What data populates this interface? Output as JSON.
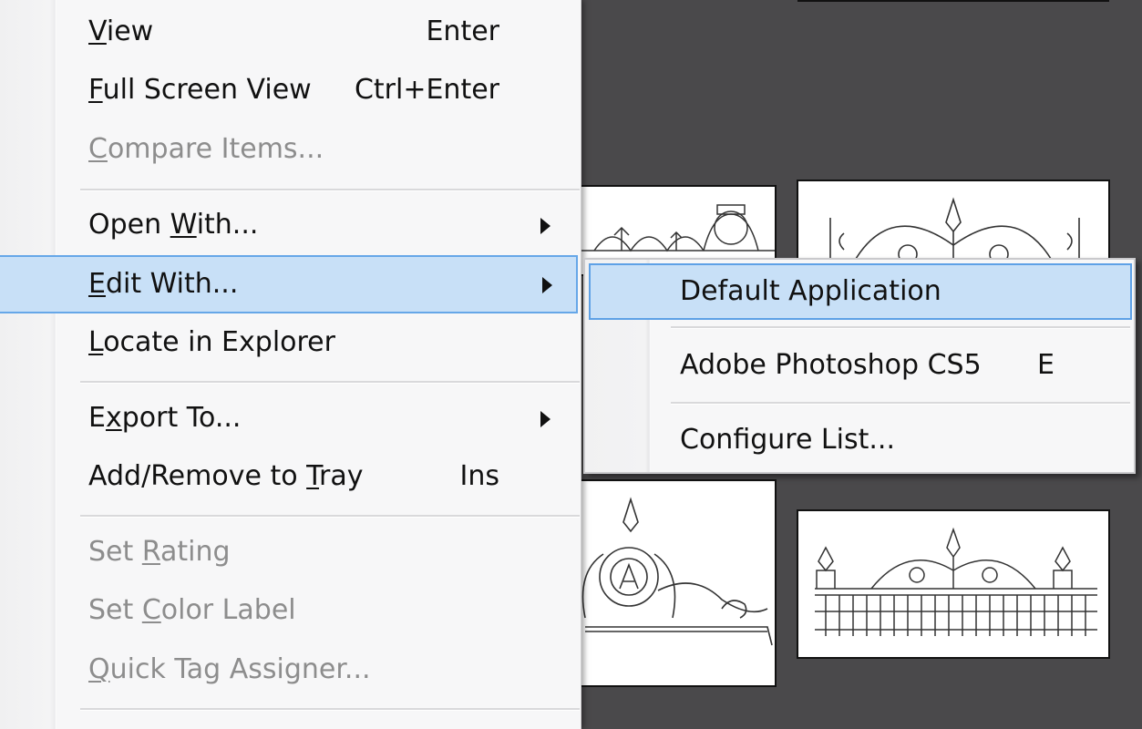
{
  "menu": {
    "items": [
      {
        "label": "View",
        "underline_index": 0,
        "shortcut": "Enter",
        "enabled": true
      },
      {
        "label": "Full Screen View",
        "underline_index": 0,
        "shortcut": "Ctrl+Enter",
        "enabled": true
      },
      {
        "label": "Compare Items...",
        "underline_index": 0,
        "shortcut": "",
        "enabled": false
      },
      {
        "label": "Open With...",
        "underline_index": 5,
        "shortcut": "",
        "enabled": true,
        "submenu": true
      },
      {
        "label": "Edit With...",
        "underline_index": 0,
        "shortcut": "",
        "enabled": true,
        "submenu": true,
        "highlighted": true
      },
      {
        "label": "Locate in Explorer",
        "underline_index": 0,
        "shortcut": "",
        "enabled": true
      },
      {
        "label": "Export To...",
        "underline_index": 1,
        "shortcut": "",
        "enabled": true,
        "submenu": true
      },
      {
        "label": "Add/Remove to Tray",
        "underline_index": 14,
        "shortcut": "Ins",
        "enabled": true
      },
      {
        "label": "Set Rating",
        "underline_index": 4,
        "shortcut": "",
        "enabled": false
      },
      {
        "label": "Set Color Label",
        "underline_index": 4,
        "shortcut": "",
        "enabled": false
      },
      {
        "label": "Quick Tag Assigner...",
        "underline_index": 0,
        "shortcut": "",
        "enabled": false
      }
    ]
  },
  "submenu": {
    "items": [
      {
        "label": "Default Application",
        "shortcut": "",
        "highlighted": true
      },
      {
        "label": "Adobe Photoshop CS5",
        "shortcut": "E"
      },
      {
        "label": "Configure List...",
        "shortcut": ""
      }
    ]
  },
  "colors": {
    "highlight_fill": "#c8e0f7",
    "highlight_border": "#66a7e8",
    "background": "#4a494b",
    "disabled_text": "#8d8d8d"
  }
}
